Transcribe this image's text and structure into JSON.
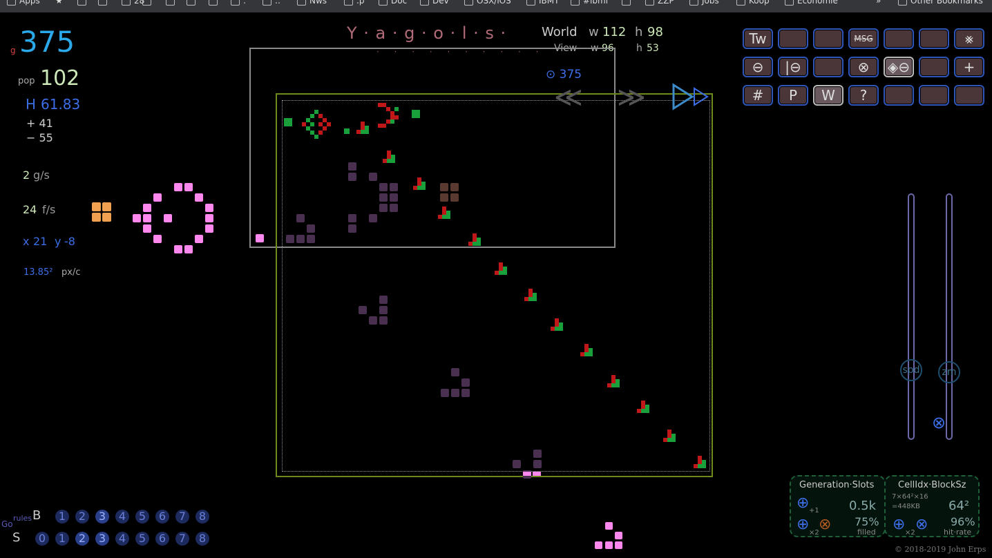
{
  "bookmarks": [
    {
      "label": "Apps"
    },
    {
      "label": "★"
    },
    {
      "label": ""
    },
    {
      "label": ""
    },
    {
      "label": "28"
    },
    {
      "label": ""
    },
    {
      "label": ""
    },
    {
      "label": ""
    },
    {
      "label": ""
    },
    {
      "label": ":"
    },
    {
      "label": "::"
    },
    {
      "label": "Nws"
    },
    {
      "label": ".p"
    },
    {
      "label": "Doc"
    },
    {
      "label": "Dev"
    },
    {
      "label": "OSX/iOS"
    },
    {
      "label": "IBMT"
    },
    {
      "label": "#ibmi"
    },
    {
      "label": ""
    },
    {
      "label": "ZZP"
    },
    {
      "label": "Jobs"
    },
    {
      "label": "Koop"
    },
    {
      "label": "Economie"
    },
    {
      "label": "»"
    },
    {
      "label": "Other Bookmarks"
    }
  ],
  "stats": {
    "gen_prefix": "g",
    "generation": "375",
    "pop_label": "pop",
    "population": "102",
    "h_label": "H",
    "entropy": "61.83",
    "plus": "+ 41",
    "minus": "− 55",
    "gps_value": "2",
    "gps_unit": "g/s",
    "fps_value": "24",
    "fps_unit": "f/s",
    "x_label": "x",
    "x_value": "21",
    "y_label": "y",
    "y_value": "-8",
    "scale_value": "13.85²",
    "scale_unit": "px/c"
  },
  "title": {
    "text": "Y · a · g · o · l · s ·",
    "dots": "· · · · · · · · · ·"
  },
  "world": {
    "label": "World",
    "w_label": "w",
    "w": "112",
    "h_label": "h",
    "h": "98",
    "view_label": "View",
    "vw_label": "w",
    "vw": "96",
    "vh_label": "h",
    "vh": "53",
    "gen_marker": "⊙ 375"
  },
  "nav": {
    "left": "≪",
    "right": "≫"
  },
  "buttons": [
    {
      "label": "Tw"
    },
    {
      "label": ""
    },
    {
      "label": ""
    },
    {
      "label": "MSG"
    },
    {
      "label": ""
    },
    {
      "label": ""
    },
    {
      "label": "⨳"
    },
    {
      "label": "⊖"
    },
    {
      "label": "|⊖"
    },
    {
      "label": ""
    },
    {
      "label": "⊗"
    },
    {
      "label": "◈⊖"
    },
    {
      "label": ""
    },
    {
      "label": "+"
    },
    {
      "label": "#"
    },
    {
      "label": "P"
    },
    {
      "label": "W"
    },
    {
      "label": "?"
    },
    {
      "label": ""
    },
    {
      "label": ""
    },
    {
      "label": ""
    }
  ],
  "sliders": {
    "speed_label": "spd",
    "zoom_label": "zm",
    "reset": "⊗"
  },
  "rules": {
    "go_label": "Go",
    "rules_label": "rules",
    "b_label": "B",
    "s_label": "S",
    "b_digits": [
      "1",
      "2",
      "3",
      "4",
      "5",
      "6",
      "7",
      "8"
    ],
    "b_active": [
      "3"
    ],
    "s_digits": [
      "0",
      "1",
      "2",
      "3",
      "4",
      "5",
      "6",
      "7",
      "8"
    ],
    "s_active": [
      "2",
      "3"
    ]
  },
  "gen_slots": {
    "title": "Generation·Slots",
    "value": "0.5k",
    "pct": "75%",
    "pct_label": "filled",
    "plus_small": "+1",
    "times": "×2"
  },
  "cell_idx": {
    "title": "CellIdx·BlockSz",
    "dims": "7×64²×16",
    "mem": "=448KB",
    "value": "64²",
    "pct": "96%",
    "pct_label": "hit·rate",
    "times": "×2"
  },
  "copyright": "© 2018-2019 John Erps",
  "colors": {
    "gen": "#2aa8e8",
    "pop": "#cde8b8",
    "entropy": "#3c6ee8",
    "world_frame": "#6e8a1c",
    "view_frame": "#9a9a9a",
    "button_border": "#2e56b8",
    "button_fill": "#4a3538",
    "alive_green": "#1aa03a",
    "alive_red": "#c01818",
    "dead_purple": "#4a3050",
    "pink": "#ff88ee",
    "orange": "#f0a050"
  }
}
